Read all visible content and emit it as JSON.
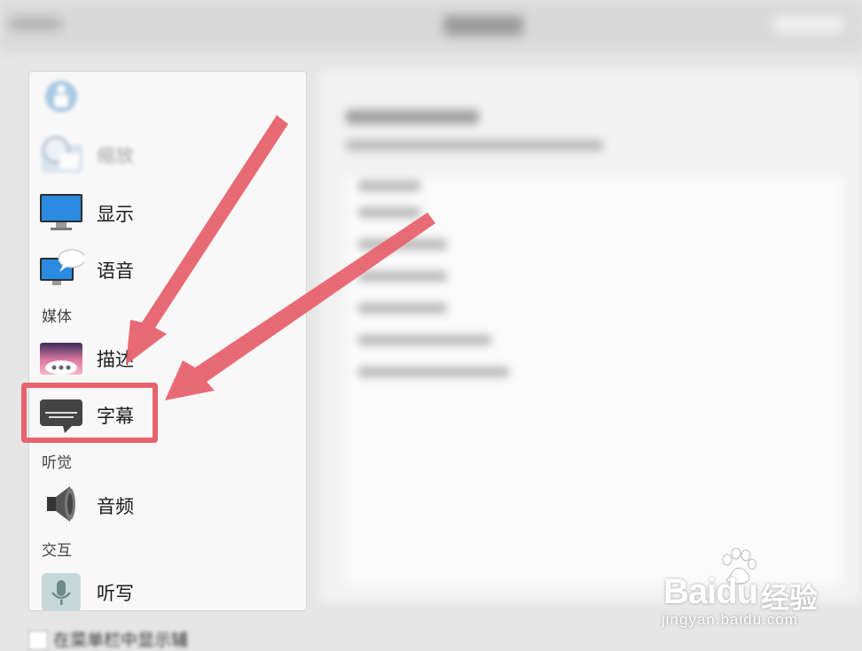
{
  "sidebar": {
    "items": [
      {
        "label": "",
        "icon": "general-icon"
      },
      {
        "label": "缩放",
        "icon": "zoom-icon"
      },
      {
        "label": "显示",
        "icon": "display-icon"
      },
      {
        "label": "语音",
        "icon": "speech-icon"
      },
      {
        "label": "描述",
        "icon": "descriptions-icon"
      },
      {
        "label": "字幕",
        "icon": "captions-icon"
      },
      {
        "label": "音频",
        "icon": "audio-icon"
      },
      {
        "label": "听写",
        "icon": "dictation-icon"
      }
    ],
    "sections": {
      "media": "媒体",
      "hearing": "听觉",
      "interaction": "交互"
    }
  },
  "footer": {
    "checkbox_label": "在菜单栏中显示辅"
  },
  "annotation": {
    "highlight_color": "#e8636e"
  },
  "watermark": {
    "brand": "Baidu",
    "cn": "经验",
    "url": "jingyan.baidu.com"
  }
}
